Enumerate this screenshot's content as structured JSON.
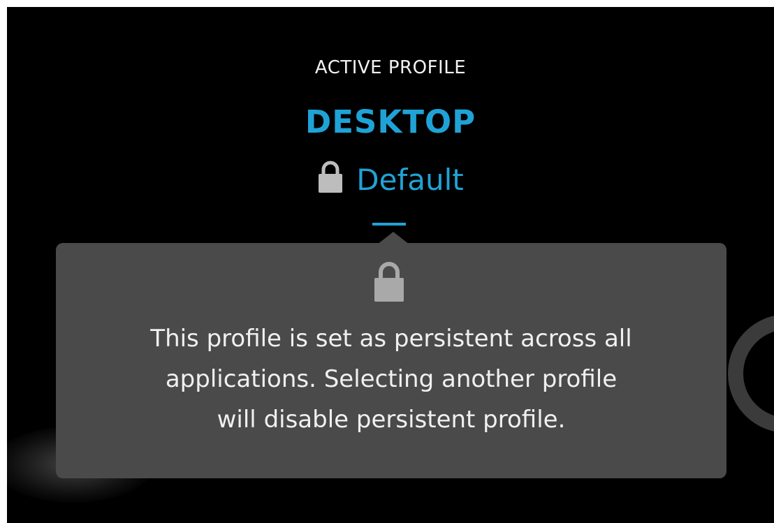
{
  "header": {
    "label": "ACTIVE PROFILE"
  },
  "profile": {
    "name": "DESKTOP",
    "sub_profile": "Default",
    "lock_icon": "lock-icon"
  },
  "tooltip": {
    "lock_icon": "lock-icon",
    "lines": [
      "This profile is set as persistent across all",
      "applications. Selecting another profile",
      "will disable persistent profile."
    ]
  },
  "colors": {
    "accent": "#1fa3d6",
    "background": "#000000",
    "tooltip_background": "#4a4a4a",
    "text": "#f0f0f0",
    "lock": "#bdbdbd"
  }
}
